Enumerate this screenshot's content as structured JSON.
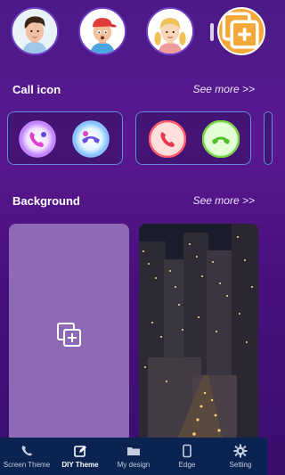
{
  "avatars": [
    {
      "name": "avatar-man-curly-hair"
    },
    {
      "name": "avatar-boy-red-cap"
    },
    {
      "name": "avatar-girl-blonde-braids"
    }
  ],
  "call_icon": {
    "title": "Call icon",
    "see_more": "See more >>"
  },
  "background": {
    "title": "Background",
    "see_more": "See more >>"
  },
  "bottom_nav": {
    "items": [
      {
        "label": "Screen Theme",
        "icon": "phone-icon"
      },
      {
        "label": "DIY Theme",
        "icon": "edit-icon"
      },
      {
        "label": "My design",
        "icon": "folder-icon"
      },
      {
        "label": "Edge",
        "icon": "device-icon"
      },
      {
        "label": "Setting",
        "icon": "gear-icon"
      }
    ],
    "active": "DIY Theme"
  },
  "colors": {
    "accent_orange": "#f5a83a",
    "nav_bg": "#0b2350",
    "tile_purple": "#8e69b6",
    "card_border": "#5f8be0"
  }
}
